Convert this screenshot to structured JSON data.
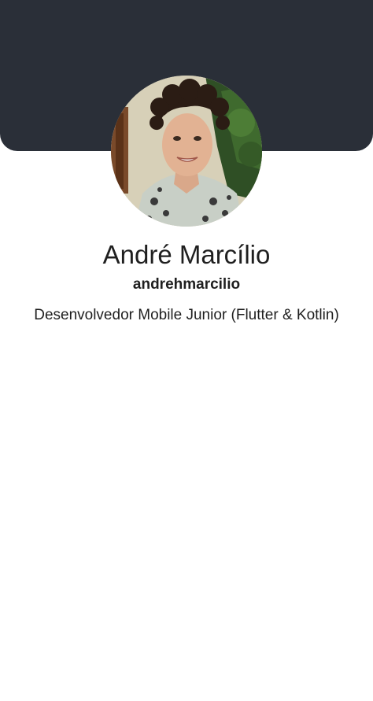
{
  "profile": {
    "name": "André Marcílio",
    "username": "andrehmarcilio",
    "bio": "Desenvolvedor Mobile Junior (Flutter & Kotlin)"
  },
  "colors": {
    "header": "#2a2f38",
    "background": "#ffffff",
    "text": "#1f1f1f"
  }
}
